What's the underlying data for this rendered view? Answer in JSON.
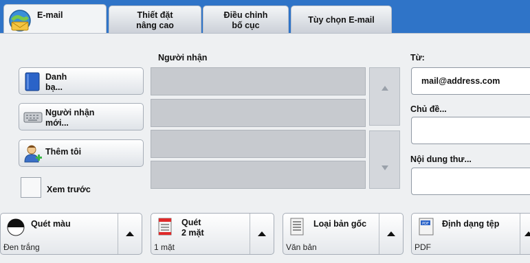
{
  "tabs": [
    {
      "label": "E-mail"
    },
    {
      "label": "Thiết đặt\nnâng cao"
    },
    {
      "label": "Điều chỉnh\nbố cục"
    },
    {
      "label": "Tùy chọn E-mail"
    }
  ],
  "left_buttons": {
    "address_book": "Danh\nbạ...",
    "new_recipient": "Người nhận\nmới...",
    "add_me": "Thêm tôi",
    "preview": "Xem trước"
  },
  "recipients": {
    "header": "Người nhận",
    "rows": [
      "",
      "",
      "",
      ""
    ]
  },
  "right_fields": {
    "from_label": "Từ:",
    "from_value": "mail@address.com",
    "subject_label": "Chủ đề...",
    "subject_value": "",
    "body_label": "Nội dung thư...",
    "body_value": ""
  },
  "bottom_buttons": [
    {
      "label": "Quét màu",
      "value": "Đen trắng"
    },
    {
      "label": "Quét\n2 mặt",
      "value": "1 mặt"
    },
    {
      "label": "Loại bản gốc",
      "value": "Văn bản"
    },
    {
      "label": "Định dạng tệp",
      "value": "PDF"
    }
  ],
  "icons": {
    "email": "email-globe-icon",
    "address_book": "book-icon",
    "new_recipient": "keyboard-icon",
    "add_me": "person-add-icon",
    "color": "color-half-circle-icon",
    "duplex": "duplex-page-icon",
    "original_type": "document-icon",
    "file_format": "pdf-icon"
  },
  "colors": {
    "tabbar": "#2f74c8",
    "panel": "#eef0f2"
  }
}
